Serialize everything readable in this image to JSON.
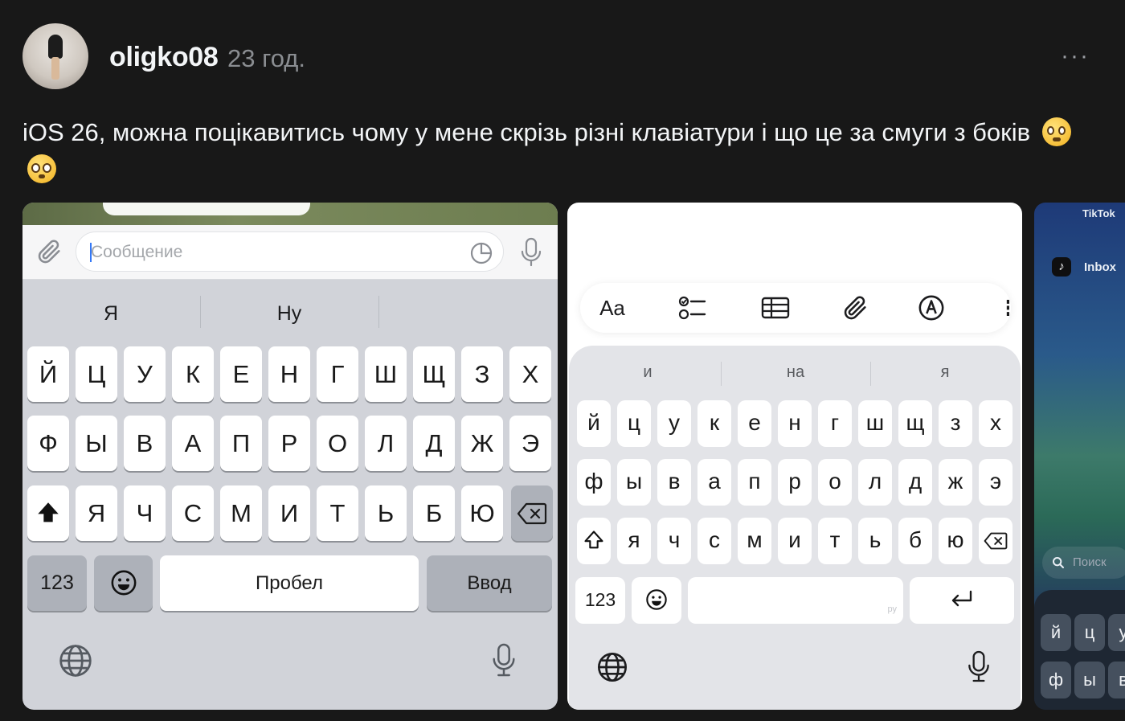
{
  "post": {
    "username": "oligko08",
    "timestamp": "23 год.",
    "more_label": "···",
    "text": "iOS 26, можна поцікавитись чому у мене скрізь різні клавіатури і що це за смуги з боків",
    "emojis": [
      "woozy-face",
      "pleading-face"
    ]
  },
  "card1": {
    "input_placeholder": "Сообщение",
    "suggestions": [
      "Я",
      "Ну",
      ""
    ],
    "row1": [
      "Й",
      "Ц",
      "У",
      "К",
      "Е",
      "Н",
      "Г",
      "Ш",
      "Щ",
      "З",
      "Х"
    ],
    "row2": [
      "Ф",
      "Ы",
      "В",
      "А",
      "П",
      "Р",
      "О",
      "Л",
      "Д",
      "Ж",
      "Э"
    ],
    "row3": [
      "Я",
      "Ч",
      "С",
      "М",
      "И",
      "Т",
      "Ь",
      "Б",
      "Ю"
    ],
    "numbers_key": "123",
    "space_key": "Пробел",
    "return_key": "Ввод"
  },
  "card2": {
    "toolbar": [
      "Aa"
    ],
    "suggestions": [
      "и",
      "на",
      "я"
    ],
    "row1": [
      "й",
      "ц",
      "у",
      "к",
      "е",
      "н",
      "г",
      "ш",
      "щ",
      "з",
      "х"
    ],
    "row2": [
      "ф",
      "ы",
      "в",
      "а",
      "п",
      "р",
      "о",
      "л",
      "д",
      "ж",
      "э"
    ],
    "row3": [
      "я",
      "ч",
      "с",
      "м",
      "и",
      "т",
      "ь",
      "б",
      "ю"
    ],
    "numbers_key": "123",
    "space_hint": "ру"
  },
  "card3": {
    "app_label": "TikTok",
    "inbox_label": "Inbox",
    "search_placeholder": "Поиск",
    "row1": [
      "й",
      "ц",
      "у"
    ],
    "row2": [
      "ф",
      "ы",
      "в"
    ]
  }
}
